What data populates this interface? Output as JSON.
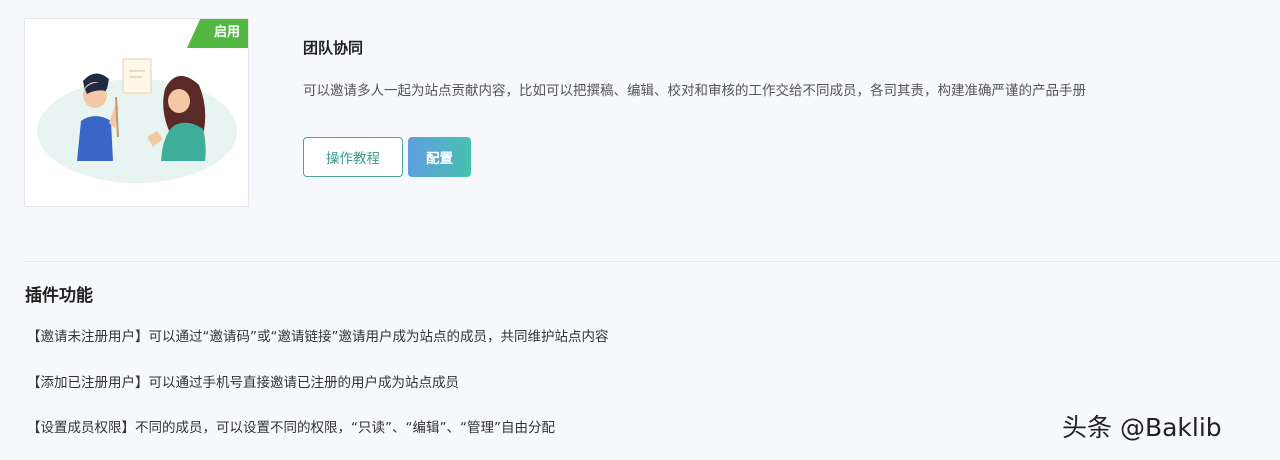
{
  "plugin": {
    "status_badge": "启用",
    "title": "团队协同",
    "description": "可以邀请多人一起为站点贡献内容，比如可以把撰稿、编辑、校对和审核的工作交给不同成员，各司其责，构建准确严谨的产品手册",
    "tutorial_button": "操作教程",
    "config_button": "配置",
    "illustration_icon": "team-collaboration-illustration"
  },
  "features": {
    "title": "插件功能",
    "items": [
      "【邀请未注册用户】可以通过“邀请码”或“邀请链接”邀请用户成为站点的成员，共同维护站点内容",
      "【添加已注册用户】可以通过手机号直接邀请已注册的用户成为站点成员",
      "【设置成员权限】不同的成员，可以设置不同的权限，“只读”、“编辑”、“管理”自由分配"
    ]
  },
  "watermark": "头条 @Baklib",
  "colors": {
    "status_green": "#52b842",
    "accent_teal": "#4aa79a",
    "config_gradient_start": "#5f9fe0",
    "config_gradient_end": "#48c0b0"
  }
}
